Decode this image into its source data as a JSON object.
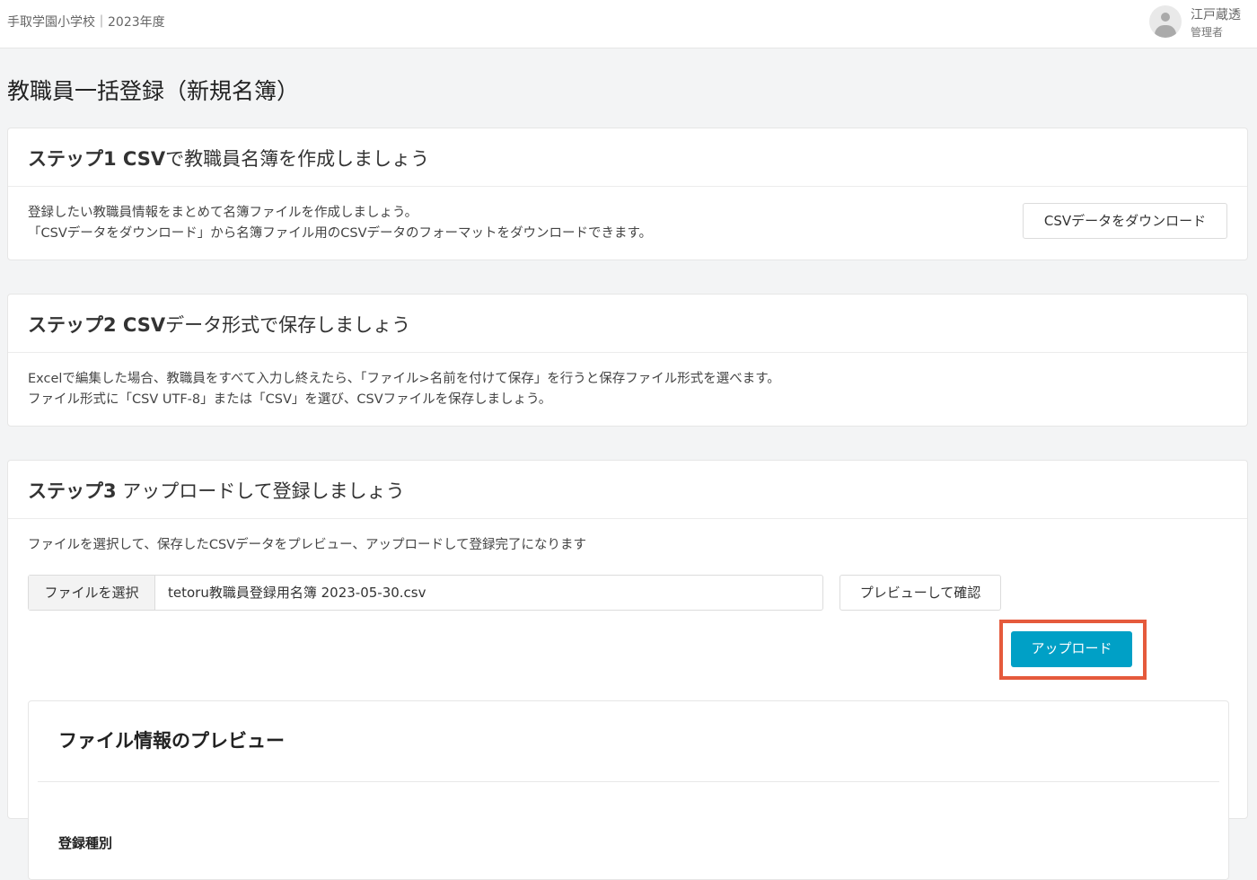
{
  "header": {
    "school": "手取学園小学校｜2023年度",
    "user_name": "江戸蔵透",
    "user_role": "管理者"
  },
  "page": {
    "title": "教職員一括登録（新規名簿）"
  },
  "step1": {
    "title_prefix": "ステップ1 CSV",
    "title_suffix": "で教職員名簿を作成しましょう",
    "line1": "登録したい教職員情報をまとめて名簿ファイルを作成しましょう。",
    "line2": "「CSVデータをダウンロード」から名簿ファイル用のCSVデータのフォーマットをダウンロードできます。",
    "button_label": "CSVデータをダウンロード"
  },
  "step2": {
    "title_prefix": "ステップ2 CSV",
    "title_suffix": "データ形式で保存しましょう",
    "line1": "Excelで編集した場合、教職員をすべて入力し終えたら、「ファイル>名前を付けて保存」を行うと保存ファイル形式を選べます。",
    "line2": "ファイル形式に「CSV UTF-8」または「CSV」を選び、CSVファイルを保存しましょう。"
  },
  "step3": {
    "title_prefix": "ステップ3",
    "title_suffix": " アップロードして登録しましょう",
    "description": "ファイルを選択して、保存したCSVデータをプレビュー、アップロードして登録完了になります",
    "file_button_label": "ファイルを選択",
    "file_name": "tetoru教職員登録用名簿 2023-05-30.csv",
    "preview_button_label": "プレビューして確認",
    "upload_button_label": "アップロード"
  },
  "preview": {
    "title": "ファイル情報のプレビュー",
    "registration_type_label": "登録種別"
  },
  "colors": {
    "accent": "#00a0c6",
    "highlight": "#e55a3c"
  }
}
